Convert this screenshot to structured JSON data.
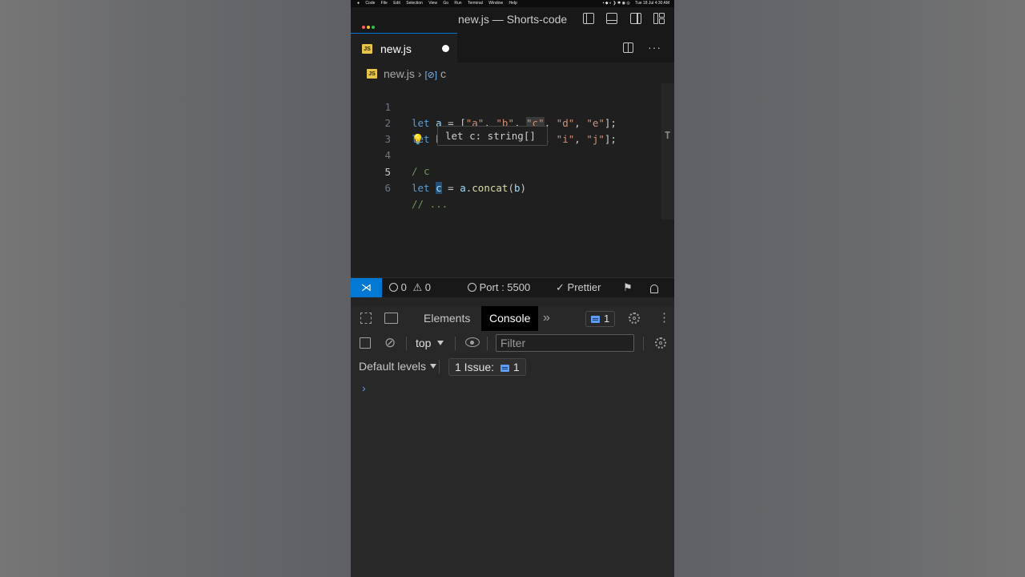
{
  "menubar": {
    "items": [
      "Code",
      "File",
      "Edit",
      "Selection",
      "View",
      "Go",
      "Run",
      "Terminal",
      "Window",
      "Help"
    ],
    "datetime": "Tue 18 Jul  4:30 AM"
  },
  "window": {
    "title": "new.js — Shorts-code"
  },
  "tab": {
    "label": "new.js",
    "file_type": "JS",
    "unsaved": true
  },
  "breadcrumb": {
    "file": "new.js",
    "symbol": "c"
  },
  "editor": {
    "lines": [
      {
        "num": "1"
      },
      {
        "num": "2"
      },
      {
        "num": "3"
      },
      {
        "num": "4"
      },
      {
        "num": "5"
      },
      {
        "num": "6"
      }
    ],
    "hover": "let c: string[]"
  },
  "statusbar": {
    "errors": "0",
    "warnings": "0",
    "port": "Port : 5500",
    "prettier": "Prettier"
  },
  "devtools": {
    "tabs": [
      "Elements",
      "Console"
    ],
    "active_tab": "Console",
    "issues_count": "1",
    "context": "top",
    "filter_placeholder": "Filter",
    "levels": "Default levels",
    "issues_label": "1 Issue:",
    "issues_num": "1"
  },
  "colors": {
    "accent": "#0078d4",
    "js_badge": "#e8c547"
  }
}
